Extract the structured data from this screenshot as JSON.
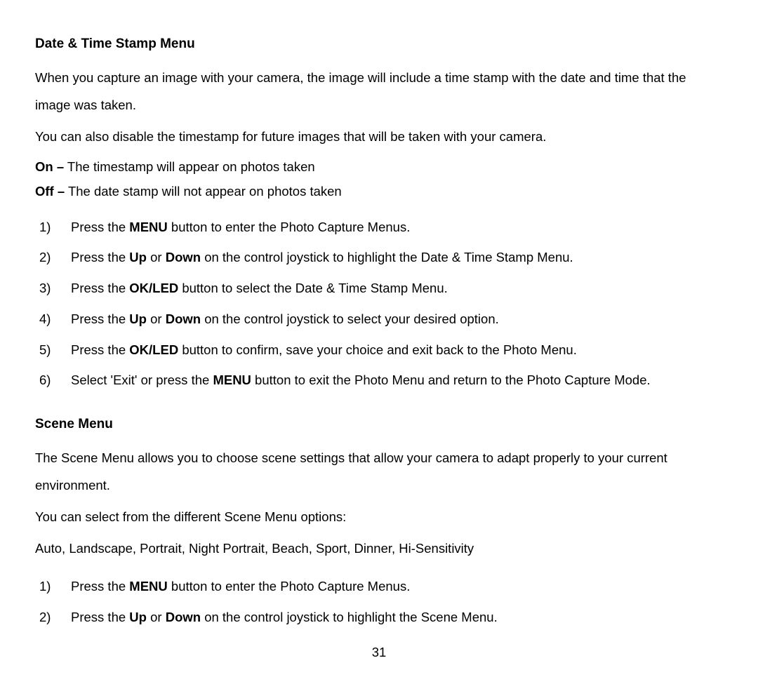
{
  "section1": {
    "heading": "Date & Time Stamp Menu",
    "para1": "When you capture an image with your camera, the image will include a time stamp with the date and time that the image was taken.",
    "para2": "You can also disable the timestamp for future images that will be taken with your camera.",
    "on_label": "On –",
    "on_text": " The timestamp will appear on photos taken",
    "off_label": "Off –",
    "off_text": " The date stamp will not appear on photos taken",
    "steps": [
      {
        "num": "1)",
        "pre": "Press the ",
        "b1": "MENU",
        "post": " button to enter the Photo Capture Menus."
      },
      {
        "num": "2)",
        "pre": "Press the ",
        "b1": "Up",
        "mid": " or ",
        "b2": "Down",
        "post": " on the control joystick to highlight the Date & Time Stamp Menu."
      },
      {
        "num": "3)",
        "pre": "Press the ",
        "b1": "OK/LED",
        "post": " button to select the Date & Time Stamp Menu."
      },
      {
        "num": "4)",
        "pre": "Press the ",
        "b1": "Up",
        "mid": " or ",
        "b2": "Down",
        "post": " on the control joystick to select your desired option."
      },
      {
        "num": "5)",
        "pre": "Press the ",
        "b1": "OK/LED",
        "post": " button to confirm, save your choice and exit back to the Photo Menu."
      },
      {
        "num": "6)",
        "pre": "Select 'Exit' or press the ",
        "b1": "MENU",
        "post": " button to exit the Photo Menu and return to the Photo Capture Mode."
      }
    ]
  },
  "section2": {
    "heading": "Scene Menu",
    "para1": "The Scene Menu allows you to choose scene settings that allow your camera to adapt properly to your current environment.",
    "para2": "You can select from the different Scene Menu options:",
    "para3": "Auto, Landscape, Portrait, Night Portrait, Beach, Sport, Dinner, Hi-Sensitivity",
    "steps": [
      {
        "num": "1)",
        "pre": "Press the ",
        "b1": "MENU",
        "post": " button to enter the Photo Capture Menus."
      },
      {
        "num": "2)",
        "pre": "Press the ",
        "b1": "Up",
        "mid": " or ",
        "b2": "Down",
        "post": " on the control joystick to highlight the Scene Menu."
      }
    ]
  },
  "page_number": "31"
}
